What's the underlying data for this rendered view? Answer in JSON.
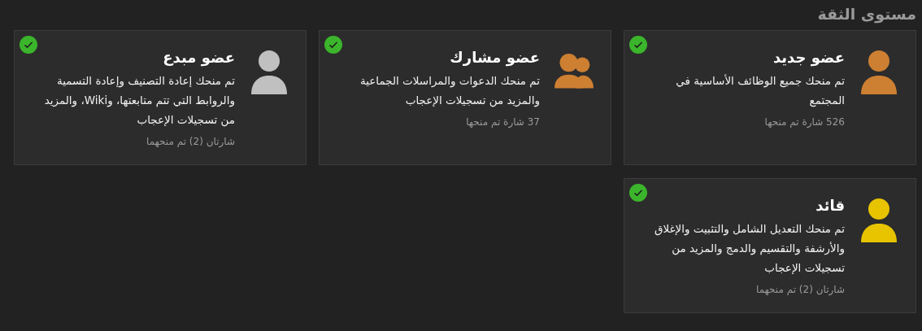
{
  "title": "مستوى الثقة",
  "levels": [
    {
      "name": "عضو جديد",
      "description": "تم منحك جميع الوظائف الأساسية في المجتمع",
      "awarded": "526 شارة تم منحها",
      "kind": "person",
      "color": "#cd7f32",
      "achieved": true
    },
    {
      "name": "عضو مشارك",
      "description": "تم منحك الدعوات والمراسلات الجماعية والمزيد من تسجيلات الإعجاب",
      "awarded": "37 شارة تم منحها",
      "kind": "group",
      "color": "#cd7f32",
      "achieved": true
    },
    {
      "name": "عضو مبدع",
      "description": "تم منحك إعادة التصنيف وإعادة التسمية والروابط التي تتم متابعتها، وWiki، والمزيد من تسجيلات الإعجاب",
      "awarded": "شارتان (2) تم منحهما",
      "kind": "person",
      "color": "#c0c0c0",
      "achieved": true
    },
    {
      "name": "قائد",
      "description": "تم منحك التعديل الشامل والتثبيت والإغلاق والأرشفة والتقسيم والدمج والمزيد من تسجيلات الإعجاب",
      "awarded": "شارتان (2) تم منحهما",
      "kind": "person",
      "color": "#e7c300",
      "achieved": true
    }
  ]
}
